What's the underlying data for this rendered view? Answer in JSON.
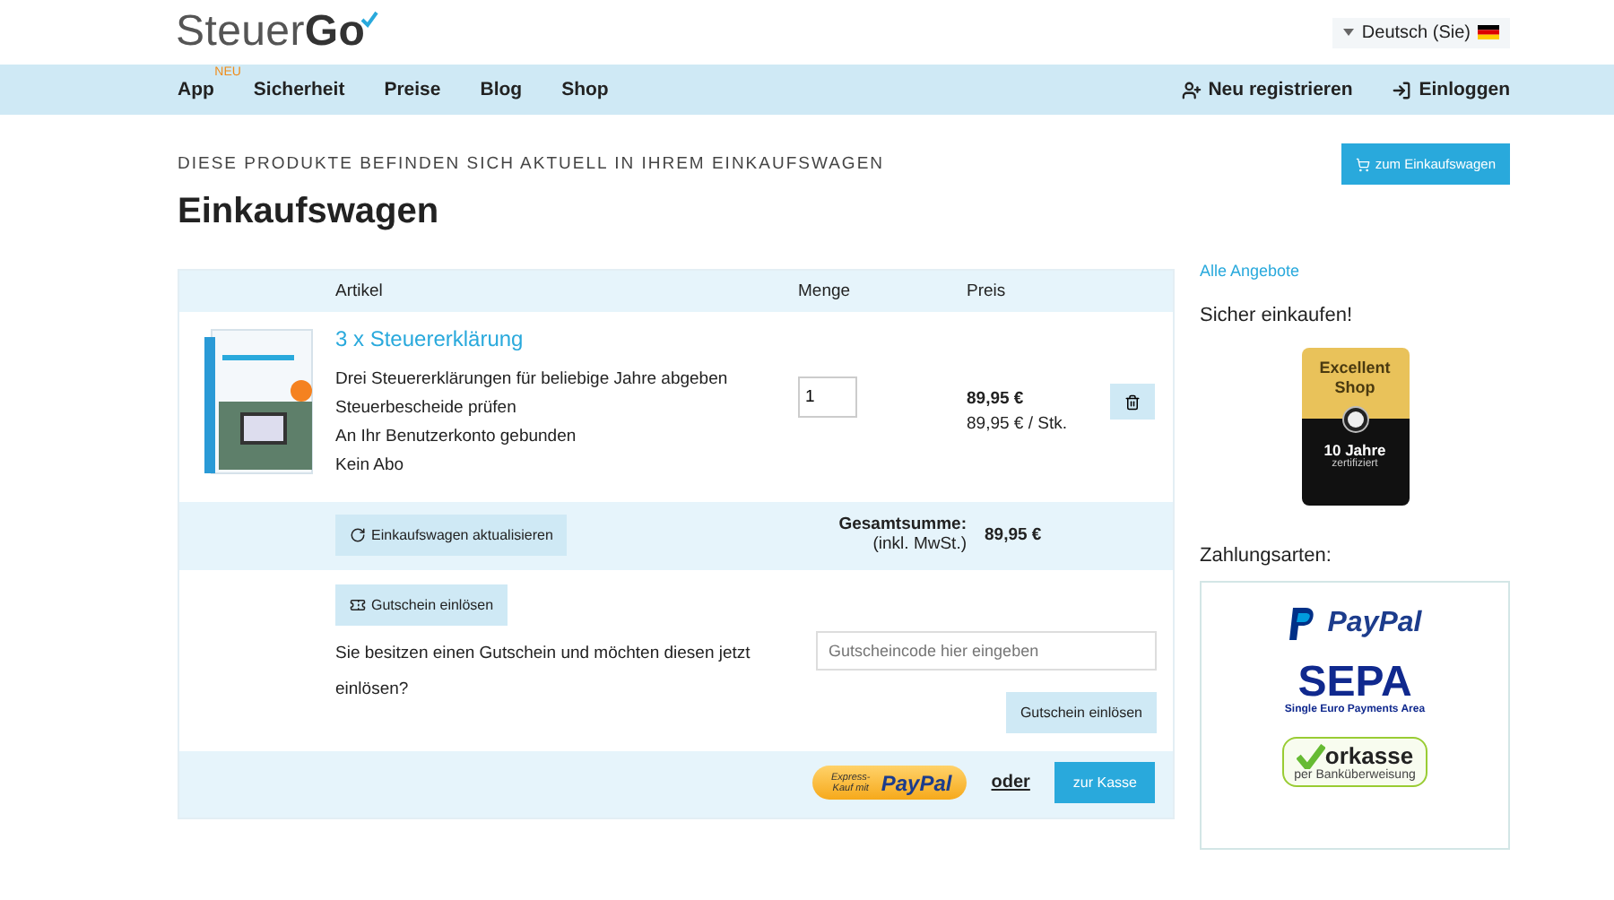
{
  "header": {
    "logo": {
      "text": "Steuer",
      "accent": "Go"
    },
    "language": "Deutsch (Sie)"
  },
  "nav": {
    "items": [
      {
        "label": "App",
        "badge": "NEU"
      },
      {
        "label": "Sicherheit"
      },
      {
        "label": "Preise"
      },
      {
        "label": "Blog"
      },
      {
        "label": "Shop"
      }
    ],
    "actions": [
      {
        "label": "Neu registrieren",
        "kind": "register"
      },
      {
        "label": "Einloggen",
        "kind": "login"
      }
    ]
  },
  "page": {
    "subtitle": "DIESE PRODUKTE BEFINDEN SICH AKTUELL IN IHREM EINKAUFSWAGEN",
    "cart_button": "zum Einkaufswagen",
    "title": "Einkaufswagen"
  },
  "cart": {
    "columns": [
      "Artikel",
      "Menge",
      "Preis"
    ],
    "items": [
      {
        "name": "3 x Steuererklärung",
        "features": [
          "Drei Steuererklärungen für beliebige Jahre abgeben",
          "Steuerbescheide prüfen",
          "An Ihr Benutzerkonto gebunden",
          "Kein Abo"
        ],
        "quantity": "1",
        "price": "89,95 €",
        "unit_price": "89,95 € / Stk."
      }
    ],
    "update_button": "Einkaufswagen aktualisieren",
    "total_label": "Gesamtsumme:",
    "tax_note": "(inkl. MwSt.)",
    "total": "89,95 €",
    "voucher_button": "Gutschein einlösen",
    "voucher_prompt": "Sie besitzen einen Gutschein und möchten diesen jetzt einlösen?",
    "voucher_placeholder": "Gutscheincode hier eingeben",
    "voucher_submit": "Gutschein einlösen",
    "express": {
      "prefix": "Express-Kauf mit",
      "brand": "PayPal"
    },
    "or": "oder",
    "checkout": "zur Kasse"
  },
  "sidebar": {
    "offers_link": "Alle Angebote",
    "secure_heading": "Sicher einkaufen!",
    "trust_badge": {
      "title": "Excellent Shop",
      "years": "10 Jahre",
      "note": "zertifiziert"
    },
    "payment_heading": "Zahlungsarten:",
    "payment_methods": [
      {
        "kind": "paypal",
        "label": "PayPal"
      },
      {
        "kind": "sepa",
        "label": "SEPA",
        "note": "Single Euro Payments Area"
      },
      {
        "kind": "vorkasse",
        "label": "orkasse",
        "note": "per Banküberweisung"
      }
    ]
  }
}
